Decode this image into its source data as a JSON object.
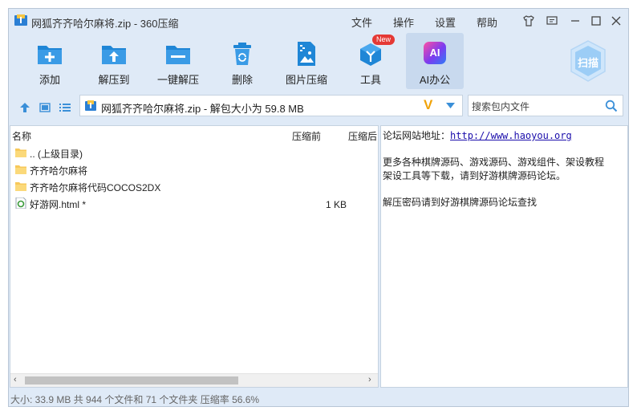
{
  "window": {
    "title": "网狐齐齐哈尔麻将.zip - 360压缩"
  },
  "menu": {
    "file": "文件",
    "action": "操作",
    "settings": "设置",
    "help": "帮助"
  },
  "toolbar": {
    "add": "添加",
    "extract_to": "解压到",
    "one_click_extract": "一键解压",
    "delete": "删除",
    "image_compress": "图片压缩",
    "tools": "工具",
    "tools_badge": "New",
    "ai": "AI办公",
    "ai_icon_text": "AI",
    "scan": "扫描"
  },
  "address": {
    "path": "网狐齐齐哈尔麻将.zip - 解包大小为 59.8 MB",
    "v_badge": "V"
  },
  "search": {
    "placeholder": "搜索包内文件"
  },
  "file_list": {
    "columns": {
      "name": "名称",
      "before": "压缩前",
      "after": "压缩后"
    },
    "rows": [
      {
        "name": ".. (上级目录)",
        "size": "",
        "icon": "folder-icon"
      },
      {
        "name": "齐齐哈尔麻将",
        "size": "",
        "icon": "folder-icon"
      },
      {
        "name": "齐齐哈尔麻将代码COCOS2DX",
        "size": "",
        "icon": "folder-icon"
      },
      {
        "name": "好游网.html *",
        "size": "1 KB",
        "icon": "html-file-icon"
      }
    ]
  },
  "notes": {
    "line1_prefix": "论坛网站地址：",
    "line1_link": "http://www.haoyou.org",
    "line2": "更多各种棋牌源码、游戏源码、游戏组件、架设教程",
    "line3": "架设工具等下载，请到好游棋牌源码论坛。",
    "line4": "解压密码请到好游棋牌源码论坛查找"
  },
  "status": {
    "text": "大小: 33.9 MB 共 944 个文件和 71 个文件夹 压缩率 56.6%"
  },
  "colors": {
    "accent_blue": "#1f86d6",
    "window_bg": "#dfeaf7",
    "badge_red": "#e53935",
    "v_orange": "#f0a30a"
  }
}
